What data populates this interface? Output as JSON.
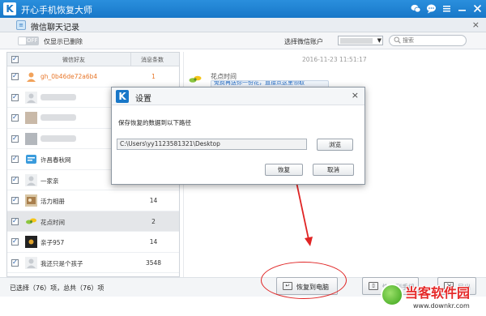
{
  "app": {
    "logo_letter": "K",
    "title": "开心手机恢复大师",
    "titlebar_icons": [
      "chat-icon",
      "message-icon",
      "menu-icon",
      "minimize-icon",
      "close-icon"
    ]
  },
  "window": {
    "title": "微信聊天记录",
    "close": "×"
  },
  "filter": {
    "toggle_state": "OFF",
    "toggle_label": "仅显示已删除",
    "account_label": "选择微信账户",
    "search_placeholder": "搜索"
  },
  "list": {
    "headers": {
      "name": "微信好友",
      "count": "消息条数"
    },
    "rows": [
      {
        "name": "gh_0b46de72a6b4",
        "count": "1",
        "checked": true,
        "highlight": true
      },
      {
        "name": "",
        "count": "",
        "checked": true,
        "blurred": true
      },
      {
        "name": "",
        "count": "",
        "checked": true,
        "blurred": true
      },
      {
        "name": "",
        "count": "",
        "checked": true,
        "blurred": true
      },
      {
        "name": "许昌春秋网",
        "count": "",
        "checked": true
      },
      {
        "name": "一家亲",
        "count": "",
        "checked": true
      },
      {
        "name": "活力相册",
        "count": "14",
        "checked": true
      },
      {
        "name": "花点时间",
        "count": "2",
        "checked": true,
        "selected": true
      },
      {
        "name": "亲子957",
        "count": "14",
        "checked": true
      },
      {
        "name": "我还只是个孩子",
        "count": "3548",
        "checked": true
      }
    ]
  },
  "chat": {
    "timestamp": "2016-11-23 11:51:17",
    "sender": "花点时间",
    "message": "免费再送你一份花，直接点这里领取"
  },
  "bottom": {
    "selection_info": "已选择（76）项，总共（76）项",
    "restore_to_pc": "恢复到电脑",
    "restore_to_phone": "恢复到手机",
    "export": "导出"
  },
  "dialog": {
    "logo_letter": "K",
    "title": "设置",
    "close": "×",
    "label": "保存恢复的数据到以下路径",
    "path": "C:\\Users\\yy1123581321\\Desktop",
    "browse": "浏览",
    "restore": "恢复",
    "cancel": "取消"
  },
  "watermark": {
    "title": "当客软件园",
    "url": "www.downkr.com"
  },
  "colors": {
    "titlebar": "#1877c8",
    "highlight_orange": "#e8772a",
    "annotation_red": "#e02424"
  }
}
